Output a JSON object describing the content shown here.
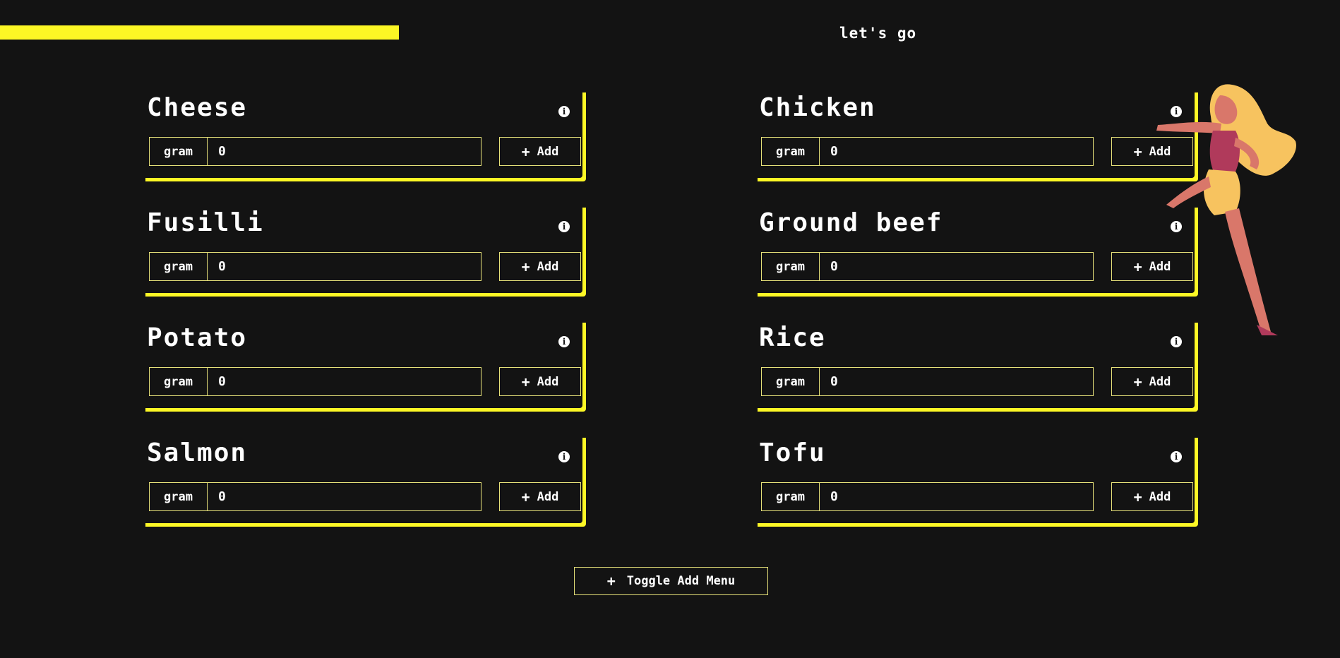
{
  "progress": {
    "percent": 49.6,
    "label": "let's go",
    "color": "#fcf725"
  },
  "colors": {
    "background": "#131313",
    "accent": "#fcf725",
    "border": "#e7e27a",
    "text": "#ffffff"
  },
  "foods": [
    {
      "name": "Cheese",
      "unit": "gram",
      "value": "0",
      "add_label": "Add",
      "icon": "info-icon"
    },
    {
      "name": "Chicken",
      "unit": "gram",
      "value": "0",
      "add_label": "Add",
      "icon": "info-icon"
    },
    {
      "name": "Fusilli",
      "unit": "gram",
      "value": "0",
      "add_label": "Add",
      "icon": "info-icon"
    },
    {
      "name": "Ground beef",
      "unit": "gram",
      "value": "0",
      "add_label": "Add",
      "icon": "info-icon"
    },
    {
      "name": "Potato",
      "unit": "gram",
      "value": "0",
      "add_label": "Add",
      "icon": "info-icon"
    },
    {
      "name": "Rice",
      "unit": "gram",
      "value": "0",
      "add_label": "Add",
      "icon": "info-icon"
    },
    {
      "name": "Salmon",
      "unit": "gram",
      "value": "0",
      "add_label": "Add",
      "icon": "info-icon"
    },
    {
      "name": "Tofu",
      "unit": "gram",
      "value": "0",
      "add_label": "Add",
      "icon": "info-icon"
    }
  ],
  "toggle_menu": {
    "label": "Toggle Add Menu",
    "icon": "plus-icon"
  },
  "decoration": {
    "icon": "running-woman-illustration"
  }
}
